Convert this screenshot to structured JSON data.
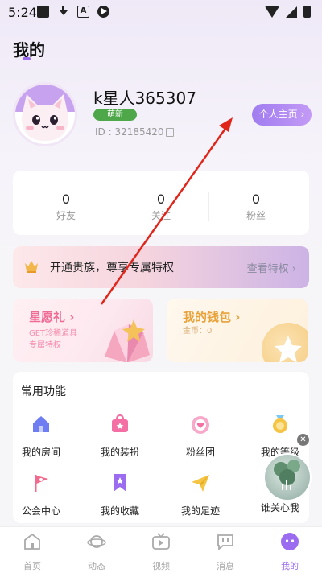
{
  "status_bar": {
    "time": "5:24"
  },
  "header": {
    "title": "我的"
  },
  "profile": {
    "username": "k星人365307",
    "badge": "萌新",
    "user_id": "ID : 32185420",
    "profile_button": "个人主页"
  },
  "stats": [
    {
      "value": "0",
      "label": "好友"
    },
    {
      "value": "0",
      "label": "关注"
    },
    {
      "value": "0",
      "label": "粉丝"
    }
  ],
  "noble_banner": {
    "text": "开通贵族，尊享专属特权",
    "link": "查看特权"
  },
  "wish_card": {
    "title": "星愿礼",
    "subtitle_line1": "GET珍稀道具",
    "subtitle_line2": "专属特权"
  },
  "wallet_card": {
    "title": "我的钱包",
    "subtitle": "金币：0"
  },
  "functions": {
    "title": "常用功能",
    "items": [
      {
        "label": "我的房间",
        "icon": "house-icon"
      },
      {
        "label": "我的装扮",
        "icon": "dress-bag-icon"
      },
      {
        "label": "粉丝团",
        "icon": "heart-badge-icon"
      },
      {
        "label": "我的等级",
        "icon": "medal-icon"
      },
      {
        "label": "公会中心",
        "icon": "flag-icon"
      },
      {
        "label": "我的收藏",
        "icon": "bookmark-icon"
      },
      {
        "label": "我的足迹",
        "icon": "paper-plane-icon"
      },
      {
        "label": "谁关心我",
        "icon": "care-icon"
      }
    ]
  },
  "tabbar": [
    {
      "label": "首页"
    },
    {
      "label": "动态"
    },
    {
      "label": "视频"
    },
    {
      "label": "消息"
    },
    {
      "label": "我的",
      "active": true
    }
  ],
  "colors": {
    "accent": "#9b6cf0",
    "annotation_arrow": "#e0261b"
  }
}
